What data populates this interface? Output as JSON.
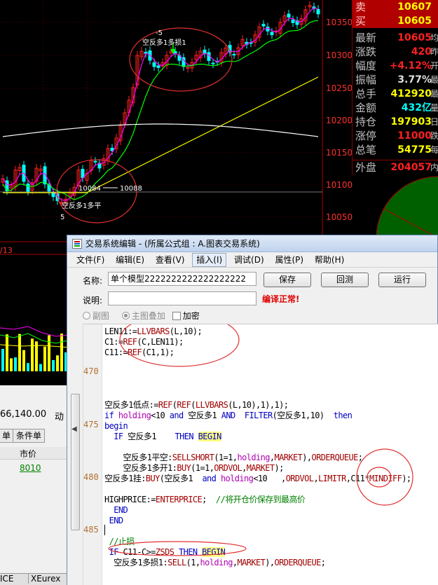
{
  "colors": {
    "up": "#ff2020",
    "down": "#00ffff",
    "ma_short": "#ff00ff",
    "ma_mid": "#00ff00",
    "ma_long": "#ffff00",
    "ma_longest": "#ffffff",
    "annotation": "#e03030"
  },
  "chart": {
    "price_labels": [
      "10350",
      "10300",
      "10250",
      "10200",
      "10150",
      "10100",
      "10050"
    ],
    "annotations": {
      "upper_marker": "-5",
      "upper_text": "空反多1多损1",
      "lower_text_1": "10084",
      "lower_text_2": "10088",
      "lower_text_3": "空反多1多平",
      "lower_text_4": "5"
    },
    "date_fragment": "/13"
  },
  "quote": {
    "sell_label": "卖",
    "sell_value": "10607",
    "buy_label": "买",
    "buy_value": "10605",
    "rows": [
      {
        "label": "最新",
        "value": "10605",
        "edge": "均"
      },
      {
        "label": "涨跌",
        "value": "420",
        "edge": "昨"
      },
      {
        "label": "幅度",
        "value": "+4.12%",
        "edge": "开"
      },
      {
        "label": "振幅",
        "value": "3.77%",
        "edge": "最"
      },
      {
        "label": "总手",
        "value": "412920",
        "edge": "最"
      },
      {
        "label": "金额",
        "value": "432亿",
        "edge": "量"
      },
      {
        "label": "持仓",
        "value": "197903",
        "edge": "日"
      },
      {
        "label": "涨停",
        "value": "11000",
        "edge": "跌"
      },
      {
        "label": "总笔",
        "value": "54775",
        "edge": "每"
      }
    ],
    "outer_label": "外盘",
    "outer_value": "204057",
    "outer_edge": "内"
  },
  "left_panel": {
    "value": "66,140.00",
    "action_label": "动",
    "btn_1": "单",
    "btn_2": "条件单",
    "column_header": "市价",
    "price": "8010",
    "tab_1": "ICE",
    "tab_2": "XEurex"
  },
  "dialog": {
    "title": "交易系统编辑 - (所属公式组 : A.图表交易系统)",
    "menus": [
      "文件(F)",
      "编辑(E)",
      "查看(V)",
      "插入(I)",
      "调试(D)",
      "属性(P)",
      "帮助(H)"
    ],
    "name_label": "名称:",
    "name_value": "单个模型2222222222222222222",
    "desc_label": "说明:",
    "desc_value": "",
    "save_label": "保存",
    "test_label": "回测",
    "run_label": "运行",
    "status": "编译正常!",
    "radio_sub": "副图",
    "radio_main": "主图叠加",
    "encrypt_label": "加密"
  },
  "editor": {
    "line_numbers": [
      "470",
      "475",
      "480",
      "485"
    ],
    "code": [
      "LEN11:=LLVBARS(L,10);",
      "C1:=REF(C,LEN11);",
      "C11:=REF(C1,1);",
      "",
      "",
      "",
      "",
      "空反多1低点:=REF(REF(LLVBARS(L,10),1),1);",
      "if holding<10 and 空反多1 AND  FILTER(空反多1,10)  then",
      "begin",
      "  IF 空反多1    THEN BEGIN",
      "",
      "    空反多1平空:SELLSHORT(1=1,holding,MARKET),ORDERQUEUE;",
      "    空反多1多开1:BUY(1=1,ORDVOL,MARKET);",
      "空反多1挂:BUY(空反多1  and holding<10   ,ORDVOL,LIMITR,C11*MINDIFF);",
      "",
      "HIGHPRICE:=ENTERPRICE;  //将开仓价保存到最高价",
      "  END",
      " END",
      "",
      " //止损",
      " IF C11-C>=ZSDS THEN BEGIN",
      "  空反多1多损1:SELL(1,holding,MARKET),ORDERQUEUE;"
    ]
  }
}
